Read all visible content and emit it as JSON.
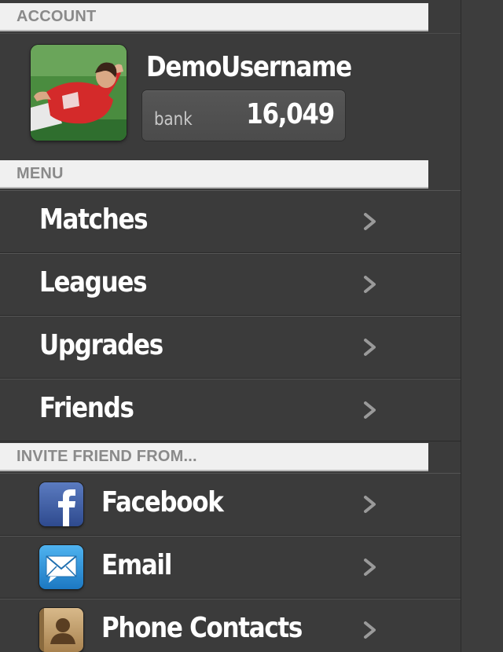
{
  "sections": {
    "account": "ACCOUNT",
    "menu": "MENU",
    "invite": "INVITE FRIEND FROM..."
  },
  "account": {
    "username": "DemoUsername",
    "bank_label": "bank",
    "bank_value": "16,049",
    "avatar_icon": "player-avatar"
  },
  "menu": {
    "items": [
      {
        "label": "Matches"
      },
      {
        "label": "Leagues"
      },
      {
        "label": "Upgrades"
      },
      {
        "label": "Friends"
      }
    ]
  },
  "invite": {
    "items": [
      {
        "label": "Facebook",
        "icon": "facebook-icon"
      },
      {
        "label": "Email",
        "icon": "mail-icon"
      },
      {
        "label": "Phone Contacts",
        "icon": "contacts-icon"
      }
    ]
  },
  "colors": {
    "background": "#3b3b3b",
    "header_bg": "#f0f0f0",
    "header_text": "#8a8a8a",
    "text": "#ffffff",
    "chevron": "#9a9a9a",
    "facebook": "#3b5998",
    "email": "#2a8fd6"
  }
}
